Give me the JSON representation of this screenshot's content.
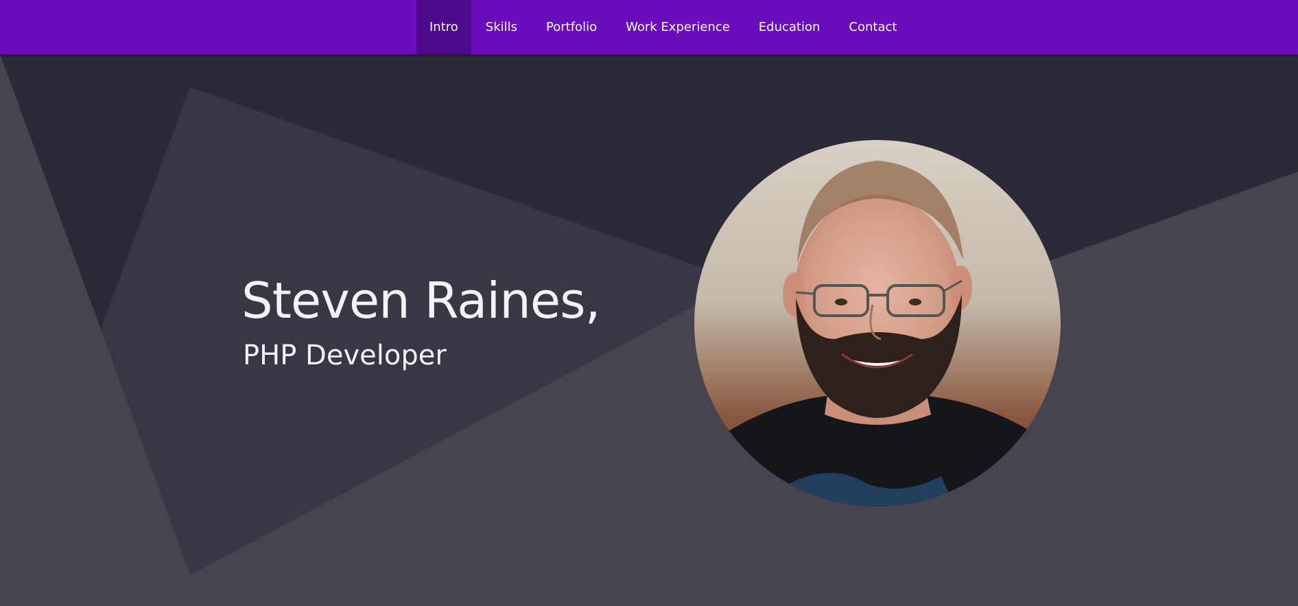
{
  "nav": {
    "items": [
      {
        "label": "Intro",
        "active": true
      },
      {
        "label": "Skills",
        "active": false
      },
      {
        "label": "Portfolio",
        "active": false
      },
      {
        "label": "Work Experience",
        "active": false
      },
      {
        "label": "Education",
        "active": false
      },
      {
        "label": "Contact",
        "active": false
      }
    ]
  },
  "intro": {
    "name": "Steven Raines,",
    "role": "PHP Developer"
  },
  "colors": {
    "nav_bg": "#6a0dbd",
    "nav_active": "#4d0a8c",
    "bg_dark": "#2d2a37",
    "bg_mid": "#3a3744",
    "bg_light": "#48444f",
    "text": "#f4f2f6"
  },
  "avatar": {
    "icon": "profile-photo"
  }
}
